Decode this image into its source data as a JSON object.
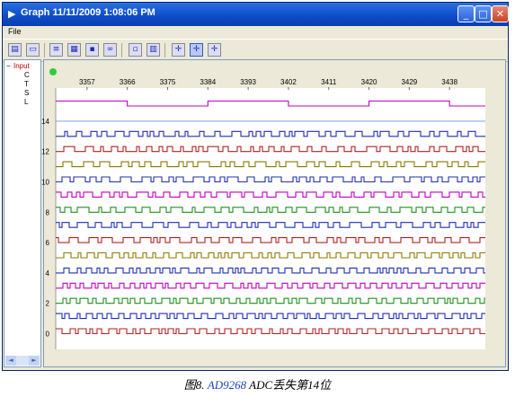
{
  "window": {
    "title": "Graph 11/11/2009 1:08:06 PM",
    "title_icon": "play-icon",
    "buttons": [
      {
        "name": "minimize-button",
        "glyph": "_"
      },
      {
        "name": "maximize-button",
        "glyph": "□"
      },
      {
        "name": "close-button",
        "glyph": "✕"
      }
    ]
  },
  "menu": {
    "file": "File"
  },
  "toolbar": {
    "tools": [
      {
        "name": "open-icon",
        "glyph": "▤"
      },
      {
        "name": "window-icon",
        "glyph": "▭"
      },
      {
        "name": "list-icon",
        "glyph": "≡"
      },
      {
        "name": "grid-icon",
        "glyph": "▦"
      },
      {
        "name": "save-icon",
        "glyph": "▪"
      },
      {
        "name": "link-icon",
        "glyph": "∞"
      },
      {
        "name": "note-icon",
        "glyph": "▫"
      },
      {
        "name": "table-icon",
        "glyph": "▥"
      },
      {
        "name": "cursor-icon",
        "glyph": "✛"
      },
      {
        "name": "cursor-pair-icon",
        "glyph": "✛"
      },
      {
        "name": "cursor-delta-icon",
        "glyph": "✛"
      }
    ]
  },
  "tree": {
    "root": "Input",
    "expand": "−",
    "children": [
      "C",
      "T",
      "S",
      "L"
    ]
  },
  "scrollbar": {
    "left": "◄",
    "right": "►"
  },
  "graph": {
    "x_ticks": [
      "3357",
      "3366",
      "3375",
      "3384",
      "3393",
      "3402",
      "3411",
      "3420",
      "3429",
      "3438"
    ],
    "y_ticks": [
      "0",
      "2",
      "4",
      "6",
      "8",
      "10",
      "12",
      "14"
    ],
    "status_indicator_color": "#2ecc40"
  },
  "chart_data": {
    "type": "line",
    "title": "",
    "xlabel": "",
    "ylabel": "",
    "x_range": [
      3350,
      3446
    ],
    "y_ticks": [
      0,
      2,
      4,
      6,
      8,
      10,
      12,
      14
    ],
    "series_note": "16 digital bit channels (0-15), square-wave traces",
    "series": [
      {
        "name": "",
        "channel": 15,
        "color": "#c000c0"
      },
      {
        "name": "",
        "channel": 14,
        "color": "#88aaff"
      },
      {
        "name": "",
        "channel": 13,
        "color": "#1f2fb3"
      },
      {
        "name": "",
        "channel": 12,
        "color": "#b22222"
      },
      {
        "name": "",
        "channel": 11,
        "color": "#8b7a00"
      },
      {
        "name": "",
        "channel": 10,
        "color": "#1f2fb3"
      },
      {
        "name": "",
        "channel": 9,
        "color": "#c000c0"
      },
      {
        "name": "",
        "channel": 8,
        "color": "#1f8f1f"
      },
      {
        "name": "",
        "channel": 7,
        "color": "#1f2fb3"
      },
      {
        "name": "",
        "channel": 6,
        "color": "#b22222"
      },
      {
        "name": "",
        "channel": 5,
        "color": "#8b7a00"
      },
      {
        "name": "",
        "channel": 4,
        "color": "#1f2fb3"
      },
      {
        "name": "",
        "channel": 3,
        "color": "#c000c0"
      },
      {
        "name": "",
        "channel": 2,
        "color": "#1f8f1f"
      },
      {
        "name": "",
        "channel": 1,
        "color": "#1f2fb3"
      },
      {
        "name": "",
        "channel": 0,
        "color": "#b22222"
      }
    ]
  },
  "caption": {
    "prefix": "图8.",
    "link": "AD9268",
    "suffix": "ADC丢失第14位"
  }
}
